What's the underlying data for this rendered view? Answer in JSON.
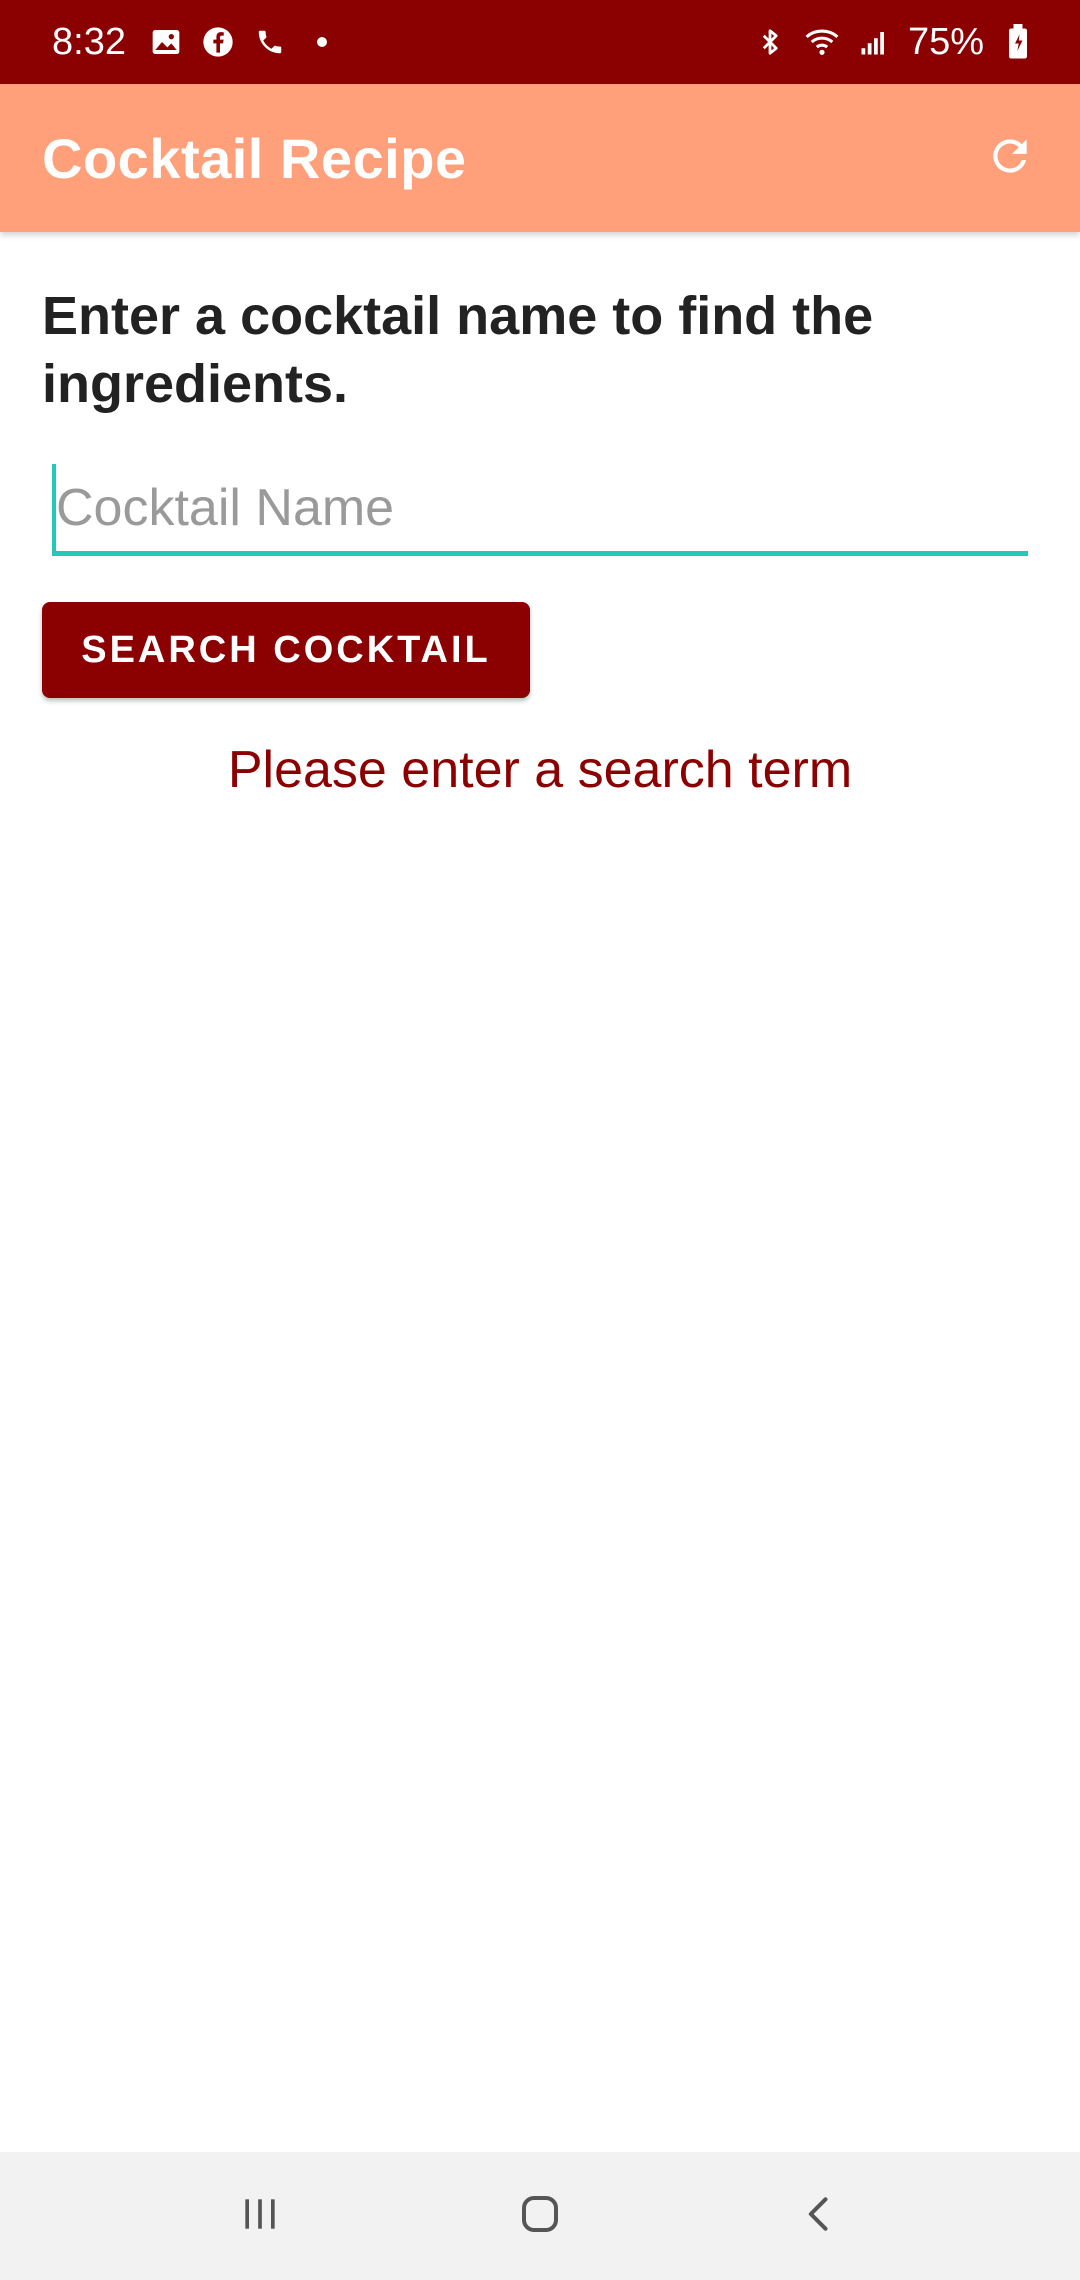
{
  "status_bar": {
    "time": "8:32",
    "battery": "75%",
    "icons": [
      "image-icon",
      "facebook-icon",
      "phone-icon",
      "dot-icon",
      "bluetooth-icon",
      "wifi-icon",
      "signal-icon",
      "battery-icon"
    ]
  },
  "app_bar": {
    "title": "Cocktail Recipe",
    "action_icon": "refresh-icon"
  },
  "main": {
    "instruction": "Enter a cocktail name to find the ingredients.",
    "search_placeholder": "Cocktail Name",
    "search_value": "",
    "search_button_label": "SEARCH COCKTAIL",
    "error_message": "Please enter a search term"
  },
  "nav_bar": {
    "buttons": [
      "recents-icon",
      "home-icon",
      "back-icon"
    ]
  },
  "colors": {
    "status_bar": "#8b0000",
    "app_bar": "#ffa07a",
    "accent": "#26c6b8",
    "button": "#8b0000",
    "error": "#8b0000"
  }
}
